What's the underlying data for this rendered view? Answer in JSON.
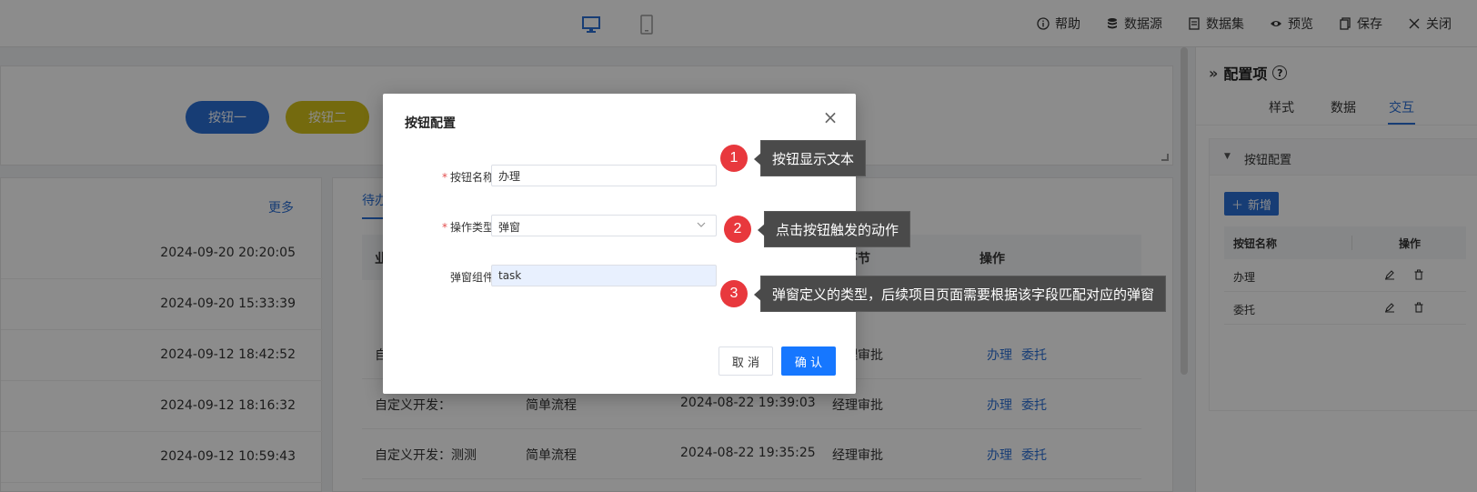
{
  "topbar": {
    "actions": [
      {
        "icon": "info-icon",
        "label": "帮助"
      },
      {
        "icon": "database-icon",
        "label": "数据源"
      },
      {
        "icon": "dataset-icon",
        "label": "数据集"
      },
      {
        "icon": "eye-icon",
        "label": "预览"
      },
      {
        "icon": "save-icon",
        "label": "保存"
      },
      {
        "icon": "close-icon",
        "label": "关闭"
      }
    ]
  },
  "canvas": {
    "button1": "按钮一",
    "button2": "按钮二",
    "button1_color": "#2b6fd6",
    "button2_color": "#d4c21a"
  },
  "left_panel": {
    "more": "更多",
    "times": [
      "2024-09-20 20:20:05",
      "2024-09-20 15:33:39",
      "2024-09-12 18:42:52",
      "2024-09-12 18:16:32",
      "2024-09-12 10:59:43"
    ]
  },
  "mid_panel": {
    "tab": "待办",
    "headers": {
      "c1": "业",
      "c4": "前环节",
      "c5": "操作"
    },
    "rows": [
      {
        "name": "自定义开发：",
        "flow": "简单流程",
        "time": "2024-08-22 19:39:03",
        "step": "经理审批",
        "op1": "办理",
        "op2": "委托"
      },
      {
        "name": "自定义开发：测测",
        "flow": "简单流程",
        "time": "2024-08-22 19:35:25",
        "step": "经理审批",
        "op1": "办理",
        "op2": "委托"
      }
    ],
    "partial_rows": [
      {
        "name": "自",
        "step": "经理审批",
        "op1": "办理",
        "op2": "委托"
      },
      {
        "step": "经理审批",
        "op1": "办理",
        "op2": "委托"
      }
    ]
  },
  "right_panel": {
    "title": "配置项",
    "tabs": [
      "样式",
      "数据",
      "交互"
    ],
    "active_tab": "交互",
    "section": "按钮配置",
    "add": "新增",
    "col_name": "按钮名称",
    "col_op": "操作",
    "rows": [
      "办理",
      "委托"
    ]
  },
  "dialog": {
    "title": "按钮配置",
    "fields": [
      {
        "label": "按钮名称：",
        "required": true,
        "value": "办理"
      },
      {
        "label": "操作类型：",
        "required": true,
        "value": "弹窗"
      },
      {
        "label": "弹窗组件：",
        "required": false,
        "value": "task"
      }
    ],
    "cancel": "取 消",
    "ok": "确 认"
  },
  "callouts": [
    {
      "num": "1",
      "text": "按钮显示文本"
    },
    {
      "num": "2",
      "text": "点击按钮触发的动作"
    },
    {
      "num": "3",
      "text": "弹窗定义的类型，后续项目页面需要根据该字段匹配对应的弹窗"
    }
  ]
}
